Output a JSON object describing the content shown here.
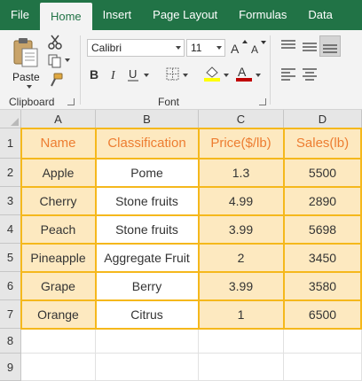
{
  "ribbon_tabs": [
    {
      "label": "File",
      "active": false
    },
    {
      "label": "Home",
      "active": true
    },
    {
      "label": "Insert",
      "active": false
    },
    {
      "label": "Page Layout",
      "active": false
    },
    {
      "label": "Formulas",
      "active": false
    },
    {
      "label": "Data",
      "active": false
    }
  ],
  "clipboard": {
    "paste_label": "Paste",
    "group_label": "Clipboard",
    "icons": [
      "paste-icon",
      "cut-icon",
      "copy-icon",
      "format-painter-icon"
    ]
  },
  "font": {
    "font_name": "Calibri",
    "font_size": "11",
    "group_label": "Font",
    "icons": [
      "increase-font-icon",
      "decrease-font-icon",
      "bold-icon",
      "italic-icon",
      "underline-icon",
      "borders-icon",
      "fill-color-icon",
      "font-color-icon"
    ],
    "fill_color": "#ffff00",
    "font_color": "#c00000"
  },
  "alignment": {
    "icons": [
      "align-top-icon",
      "align-middle-icon",
      "align-bottom-icon",
      "align-left-icon",
      "align-center-icon"
    ]
  },
  "sheet": {
    "column_headers": [
      "A",
      "B",
      "C",
      "D"
    ],
    "row_numbers": [
      "1",
      "2",
      "3",
      "4",
      "5",
      "6",
      "7",
      "8",
      "9"
    ],
    "header_row": [
      "Name",
      "Classification",
      "Price($/lb)",
      "Sales(lb)"
    ],
    "rows": [
      [
        "Apple",
        "Pome",
        "1.3",
        "5500"
      ],
      [
        "Cherry",
        "Stone fruits",
        "4.99",
        "2890"
      ],
      [
        "Peach",
        "Stone fruits",
        "3.99",
        "5698"
      ],
      [
        "Pineapple",
        "Aggregate Fruit",
        "2",
        "3450"
      ],
      [
        "Grape",
        "Berry",
        "3.99",
        "3580"
      ],
      [
        "Orange",
        "Citrus",
        "1",
        "6500"
      ]
    ],
    "header_fill": "#fde9c0",
    "header_text_color": "#ed7d31",
    "table_border_color": "#f5b81c"
  },
  "colors": {
    "ribbon_green": "#217346",
    "ribbon_bg": "#f3f3f3"
  }
}
